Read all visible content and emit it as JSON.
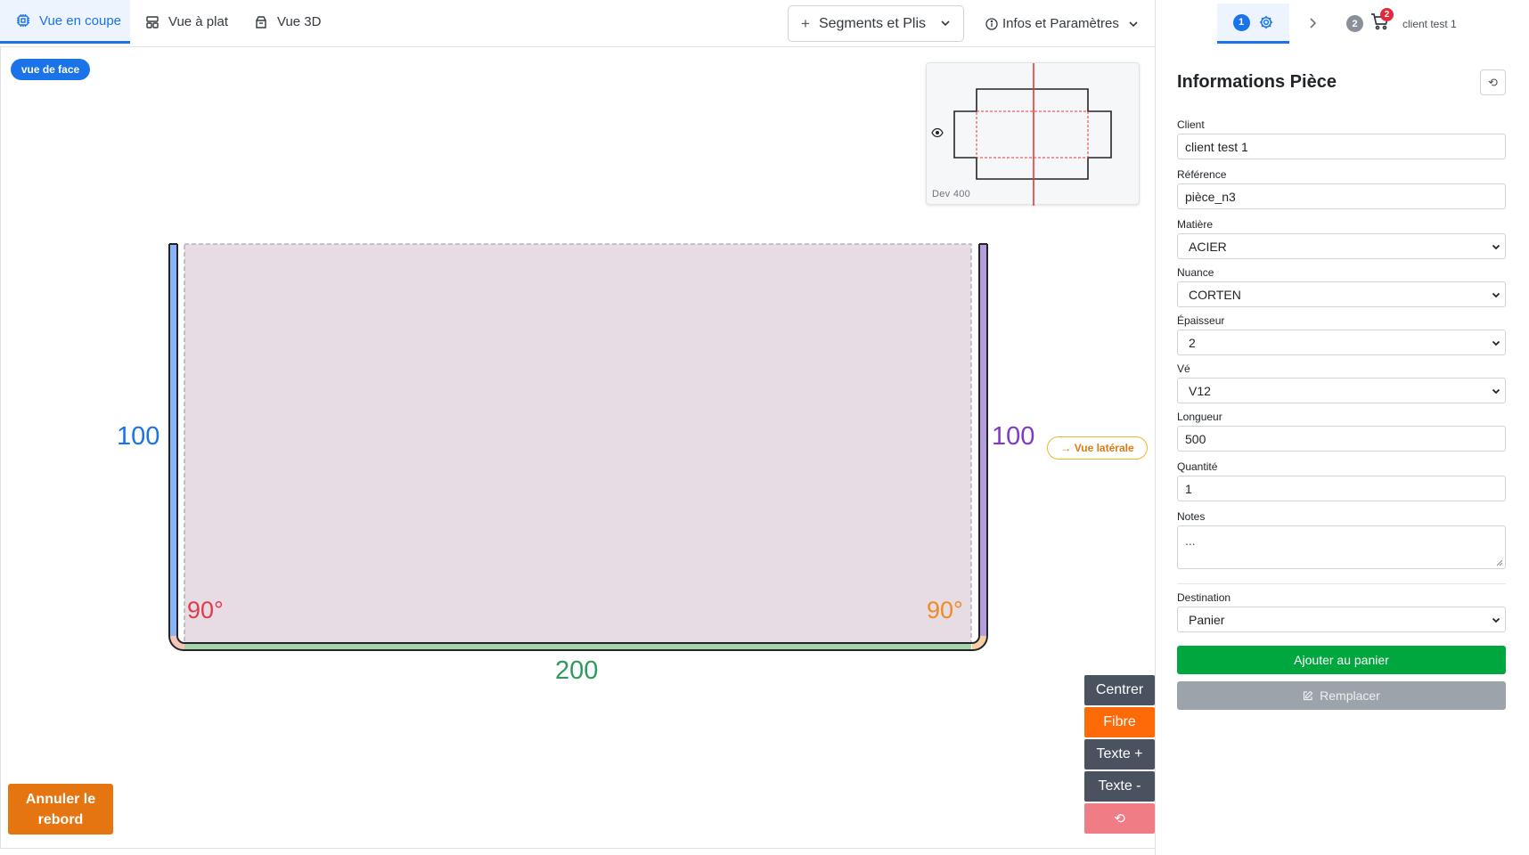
{
  "tabs": {
    "coupe": "Vue en coupe",
    "plat": "Vue à plat",
    "trois_d": "Vue 3D",
    "active": "coupe"
  },
  "toolbar": {
    "segments_label": "Segments et Plis",
    "infos_label": "Infos et Paramètres"
  },
  "canvas": {
    "view_badge": "vue de face",
    "minimap_label": "Dev 400",
    "side_view_label": "→ Vue latérale",
    "segments": {
      "left_height": "100",
      "right_height": "100",
      "bottom_width": "200"
    },
    "angles": {
      "left": "90°",
      "right": "90°"
    },
    "colors": {
      "left_segment": "#8ab4f8",
      "right_segment": "#b39ddb",
      "bottom_segment": "#a5d6a7",
      "fill": "#e8dce4",
      "left_angle": "#e03b49",
      "right_angle": "#f08a24",
      "minimap_axis": "#e53935"
    }
  },
  "controls": {
    "center": "Centrer",
    "fibre": "Fibre",
    "text_plus": "Texte +",
    "text_minus": "Texte -",
    "reset": "⟲",
    "cancel_flange": "Annuler le rebord"
  },
  "steps": {
    "step1_number": "1",
    "step2_number": "2",
    "cart_count": "2",
    "client": "client test 1"
  },
  "panel": {
    "title": "Informations Pièce",
    "reset": "⟲",
    "fields": {
      "client": {
        "label": "Client",
        "value": "client test 1"
      },
      "reference": {
        "label": "Référence",
        "value": "pièce_n3"
      },
      "matiere": {
        "label": "Matière",
        "value": "ACIER"
      },
      "nuance": {
        "label": "Nuance",
        "value": "CORTEN"
      },
      "epaisseur": {
        "label": "Épaisseur",
        "value": "2"
      },
      "ve": {
        "label": "Vé",
        "value": "V12"
      },
      "longueur": {
        "label": "Longueur",
        "value": "500"
      },
      "quantite": {
        "label": "Quantité",
        "value": "1"
      },
      "notes": {
        "label": "Notes",
        "value": "..."
      },
      "destination": {
        "label": "Destination",
        "value": "Panier"
      }
    },
    "add_to_cart": "Ajouter au panier",
    "replace": "Remplacer"
  }
}
